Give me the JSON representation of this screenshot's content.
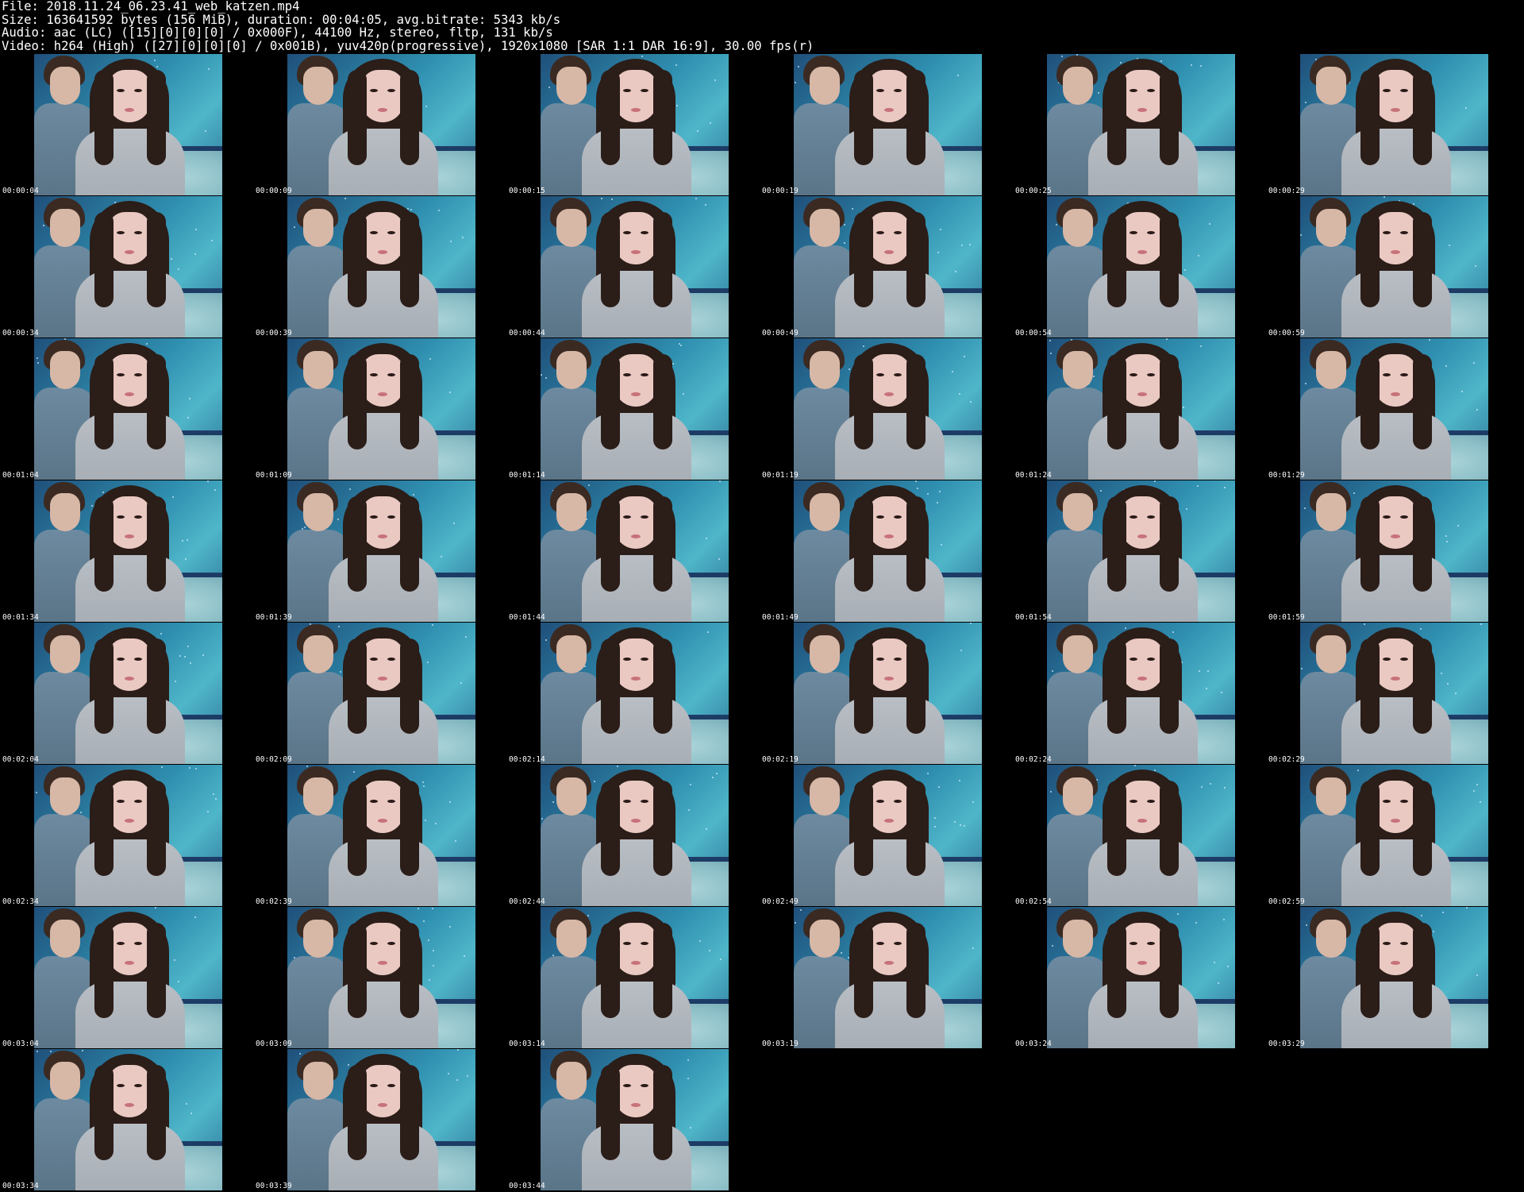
{
  "header": {
    "file_line": "File: 2018.11.24_06.23.41_web_katzen.mp4",
    "size_line": "Size: 163641592 bytes (156 MiB), duration: 00:04:05, avg.bitrate: 5343 kb/s",
    "audio_line": "Audio: aac (LC) ([15][0][0][0] / 0x000F), 44100 Hz, stereo, fltp, 131 kb/s",
    "video_line": "Video: h264 (High) ([27][0][0][0] / 0x001B), yuv420p(progressive), 1920x1080 [SAR 1:1 DAR 16:9], 30.00 fps(r)"
  },
  "thumbnails": [
    {
      "timestamp": "00:00:04"
    },
    {
      "timestamp": "00:00:09"
    },
    {
      "timestamp": "00:00:15"
    },
    {
      "timestamp": "00:00:19"
    },
    {
      "timestamp": "00:00:25"
    },
    {
      "timestamp": "00:00:29"
    },
    {
      "timestamp": "00:00:34"
    },
    {
      "timestamp": "00:00:39"
    },
    {
      "timestamp": "00:00:44"
    },
    {
      "timestamp": "00:00:49"
    },
    {
      "timestamp": "00:00:54"
    },
    {
      "timestamp": "00:00:59"
    },
    {
      "timestamp": "00:01:04"
    },
    {
      "timestamp": "00:01:09"
    },
    {
      "timestamp": "00:01:14"
    },
    {
      "timestamp": "00:01:19"
    },
    {
      "timestamp": "00:01:24"
    },
    {
      "timestamp": "00:01:29"
    },
    {
      "timestamp": "00:01:34"
    },
    {
      "timestamp": "00:01:39"
    },
    {
      "timestamp": "00:01:44"
    },
    {
      "timestamp": "00:01:49"
    },
    {
      "timestamp": "00:01:54"
    },
    {
      "timestamp": "00:01:59"
    },
    {
      "timestamp": "00:02:04"
    },
    {
      "timestamp": "00:02:09"
    },
    {
      "timestamp": "00:02:14"
    },
    {
      "timestamp": "00:02:19"
    },
    {
      "timestamp": "00:02:24"
    },
    {
      "timestamp": "00:02:29"
    },
    {
      "timestamp": "00:02:34"
    },
    {
      "timestamp": "00:02:39"
    },
    {
      "timestamp": "00:02:44"
    },
    {
      "timestamp": "00:02:49"
    },
    {
      "timestamp": "00:02:54"
    },
    {
      "timestamp": "00:02:59"
    },
    {
      "timestamp": "00:03:04"
    },
    {
      "timestamp": "00:03:09"
    },
    {
      "timestamp": "00:03:14"
    },
    {
      "timestamp": "00:03:19"
    },
    {
      "timestamp": "00:03:24"
    },
    {
      "timestamp": "00:03:29"
    },
    {
      "timestamp": "00:03:34"
    },
    {
      "timestamp": "00:03:39"
    },
    {
      "timestamp": "00:03:44"
    }
  ]
}
